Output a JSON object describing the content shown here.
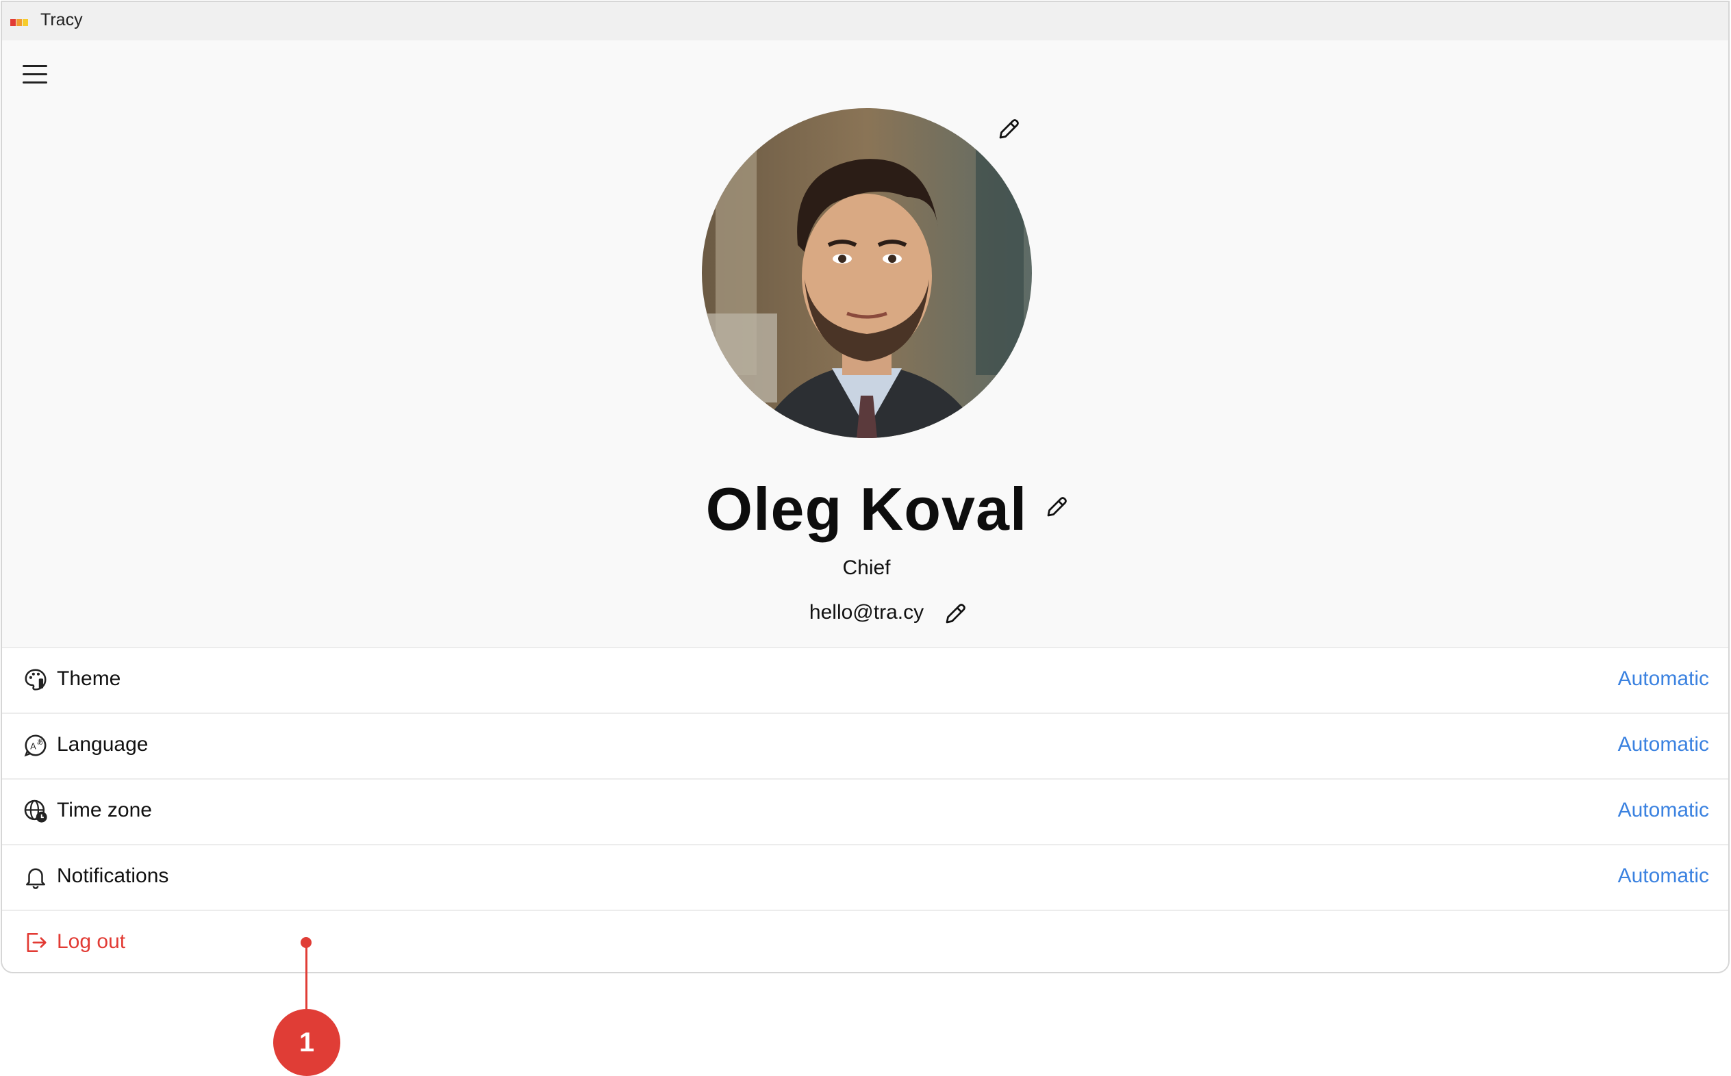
{
  "window": {
    "title": "Tracy"
  },
  "profile": {
    "name": "Oleg Koval",
    "role": "Chief",
    "email": "hello@tra.cy"
  },
  "settings": [
    {
      "label": "Theme",
      "value": "Automatic",
      "icon": "palette-icon"
    },
    {
      "label": "Language",
      "value": "Automatic",
      "icon": "language-icon"
    },
    {
      "label": "Time zone",
      "value": "Automatic",
      "icon": "globe-clock-icon"
    },
    {
      "label": "Notifications",
      "value": "Automatic",
      "icon": "bell-icon"
    }
  ],
  "logout": {
    "label": "Log out",
    "icon": "logout-icon"
  },
  "callout": {
    "number": "1"
  },
  "colors": {
    "accent": "#3b82e0",
    "danger": "#e23b34",
    "callout": "#e03d36",
    "background": "#f9f9f9"
  }
}
